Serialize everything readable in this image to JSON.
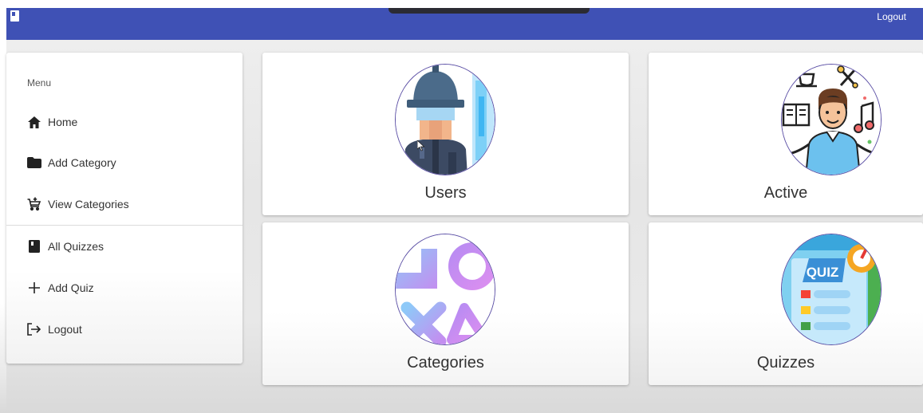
{
  "header": {
    "logout_label": "Logout"
  },
  "sidebar": {
    "heading": "Menu",
    "items": [
      {
        "label": "Home",
        "icon": "home-icon"
      },
      {
        "label": "Add Category",
        "icon": "folder-icon"
      },
      {
        "label": "View Categories",
        "icon": "cart-add-icon"
      },
      {
        "label": "All Quizzes",
        "icon": "book-icon"
      },
      {
        "label": "Add Quiz",
        "icon": "plus-icon"
      },
      {
        "label": "Logout",
        "icon": "logout-icon"
      }
    ]
  },
  "cards": [
    {
      "label": "Users",
      "icon": "user-illustration"
    },
    {
      "label": "Active",
      "icon": "active-hobbies-illustration"
    },
    {
      "label": "Categories",
      "icon": "shapes-illustration"
    },
    {
      "label": "Quizzes",
      "icon": "quiz-illustration"
    }
  ],
  "colors": {
    "primary": "#3f51b5",
    "card_border": "#5b4fa5"
  }
}
